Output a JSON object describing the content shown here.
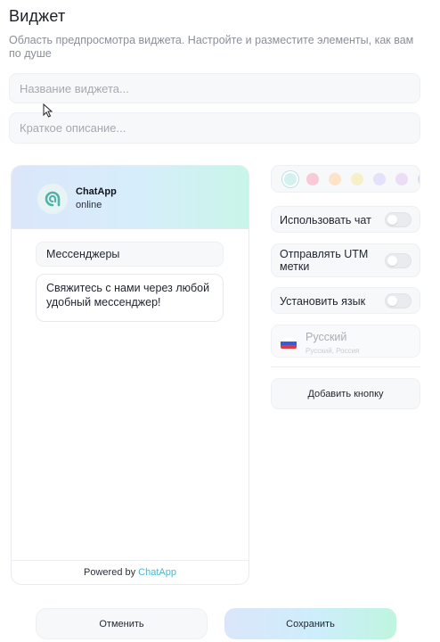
{
  "header": {
    "title": "Виджет",
    "subtitle": "Область предпросмотра виджета. Настройте и разместите элементы, как вам по душе"
  },
  "form": {
    "name_placeholder": "Название виджета...",
    "description_placeholder": "Краткое описание..."
  },
  "preview": {
    "app_name": "ChatApp",
    "status": "online",
    "messengers_label": "Мессенджеры",
    "message": "Свяжитесь с нами через любой удобный мессенджер!",
    "powered_prefix": "Powered by ",
    "powered_brand": "ChatApp"
  },
  "settings": {
    "colors": [
      "#d3f1f1",
      "#f9c9d5",
      "#fde3c8",
      "#f6f0c9",
      "#e4e2fb",
      "#ecdcf6",
      "#dad9f6"
    ],
    "selected_color": 0,
    "toggles": [
      {
        "label": "Использовать чат",
        "on": false
      },
      {
        "label": "Отправлять UTM метки",
        "on": false
      },
      {
        "label": "Установить язык",
        "on": false
      }
    ],
    "language": {
      "name": "Русский",
      "native": "Русский, Россия"
    },
    "add_button_label": "Добавить кнопку"
  },
  "footer": {
    "cancel_label": "Отменить",
    "save_label": "Сохранить"
  }
}
